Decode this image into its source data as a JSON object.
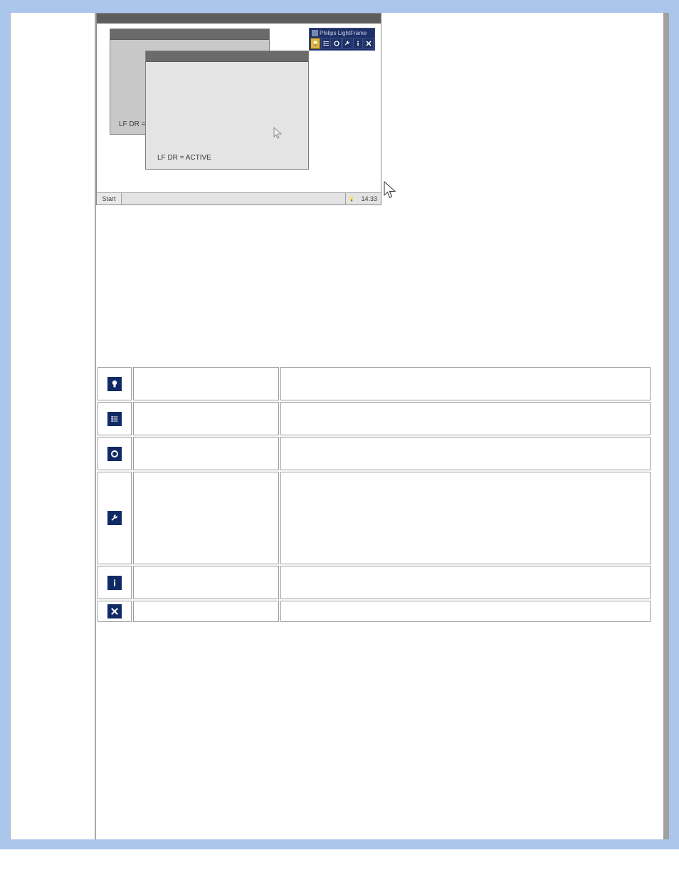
{
  "colors": {
    "page_bg": "#aac6ea",
    "chip_bg": "#102a66",
    "chip_fg": "#ffffff",
    "toolbar_btn": "#d8b44a"
  },
  "screenshot": {
    "lightframe_title": "Philips LightFrame",
    "lightframe_buttons": [
      "bulb-icon",
      "list-icon",
      "circle-icon",
      "wrench-icon",
      "info-icon",
      "close-icon"
    ],
    "back_window_text": "LF DR =",
    "front_window_text": "LF DR = ACTIVE",
    "taskbar": {
      "start_label": "Start",
      "clock": "14:33"
    }
  },
  "buttons_table": {
    "rows": [
      {
        "icon": "bulb-icon",
        "name": "",
        "desc": ""
      },
      {
        "icon": "list-icon",
        "name": "",
        "desc": ""
      },
      {
        "icon": "circle-icon",
        "name": "",
        "desc": ""
      },
      {
        "icon": "wrench-icon",
        "name": "",
        "desc": ""
      },
      {
        "icon": "info-icon",
        "name": "",
        "desc": ""
      },
      {
        "icon": "close-icon",
        "name": "",
        "desc": ""
      }
    ]
  }
}
